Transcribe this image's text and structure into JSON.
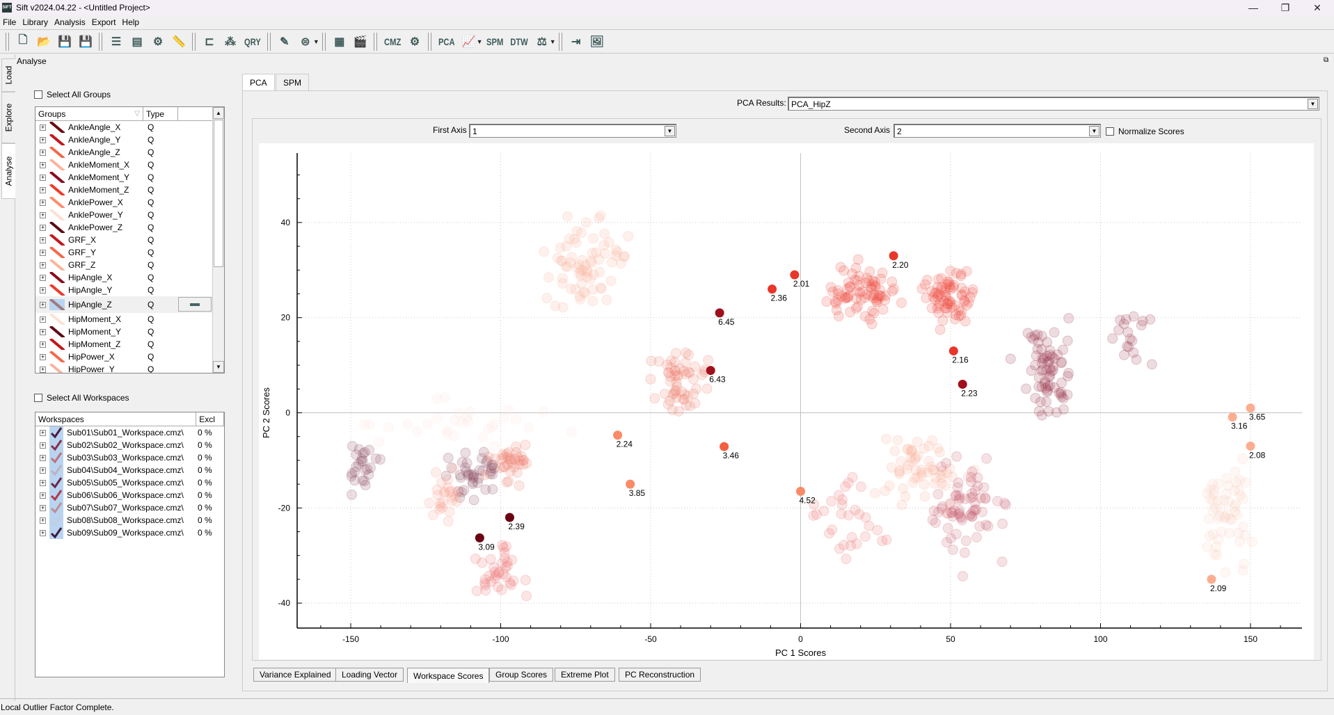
{
  "window": {
    "title": "Sift v2024.04.22 - <Untitled Project>",
    "logo": "SIFT"
  },
  "menu": [
    "File",
    "Library",
    "Analysis",
    "Export",
    "Help"
  ],
  "toolbar": {
    "groups": [
      [
        {
          "icon": "new-file-icon",
          "glyph": "🗋"
        },
        {
          "icon": "open-folder-icon",
          "glyph": "📂"
        },
        {
          "icon": "save-icon",
          "glyph": "💾"
        },
        {
          "icon": "save-as-icon",
          "glyph": "💾",
          "disabled": true
        }
      ],
      [
        {
          "icon": "sliders-icon",
          "glyph": "☰"
        },
        {
          "icon": "document-settings-icon",
          "glyph": "▤"
        },
        {
          "icon": "chart-settings-icon",
          "glyph": "⚙"
        },
        {
          "icon": "ruler-icon",
          "glyph": "📏"
        }
      ],
      [
        {
          "icon": "tree-layout-icon",
          "glyph": "⊏"
        },
        {
          "icon": "hierarchy-icon",
          "glyph": "⁂"
        },
        {
          "icon": "query-icon",
          "text": "QRY"
        }
      ],
      [
        {
          "icon": "pen-chart-icon",
          "glyph": "✎"
        },
        {
          "icon": "filter-icon",
          "glyph": "⊜",
          "menu": true
        }
      ],
      [
        {
          "icon": "film-icon",
          "glyph": "▦"
        },
        {
          "icon": "clapperboard-icon",
          "glyph": "🎬"
        }
      ],
      [
        {
          "icon": "cmz-convert-icon",
          "text": "CMZ"
        },
        {
          "icon": "gears-icon",
          "glyph": "⚙"
        }
      ],
      [
        {
          "icon": "pca-icon",
          "text": "PCA"
        },
        {
          "icon": "line-chart-icon",
          "glyph": "📈",
          "menu": true
        },
        {
          "icon": "spm-icon",
          "text": "SPM"
        },
        {
          "icon": "dtw-icon",
          "text": "DTW"
        },
        {
          "icon": "balance-icon",
          "glyph": "⚖",
          "menu": true
        }
      ],
      [
        {
          "icon": "export-icon",
          "glyph": "⇥"
        },
        {
          "icon": "export-image-icon",
          "glyph": "🖼"
        }
      ]
    ]
  },
  "side_tabs": [
    "Load",
    "Explore",
    "Analyse"
  ],
  "panel_title": "Analyse",
  "groups_panel": {
    "select_all_label": "Select All Groups",
    "headers": [
      "Groups",
      "Type",
      ""
    ],
    "rows": [
      {
        "name": "AnkleAngle_X",
        "type": "Q",
        "color": "#6b0a14"
      },
      {
        "name": "AnkleAngle_Y",
        "type": "Q",
        "color": "#c4161c"
      },
      {
        "name": "AnkleAngle_Z",
        "type": "Q",
        "color": "#f26a4a"
      },
      {
        "name": "AnkleMoment_X",
        "type": "Q",
        "color": "#fbb49c"
      },
      {
        "name": "AnkleMoment_Y",
        "type": "Q",
        "color": "#8b0a1e"
      },
      {
        "name": "AnkleMoment_Z",
        "type": "Q",
        "color": "#ee3a2c"
      },
      {
        "name": "AnklePower_X",
        "type": "Q",
        "color": "#fb8f6e"
      },
      {
        "name": "AnklePower_Y",
        "type": "Q",
        "color": "#fde0d4"
      },
      {
        "name": "AnklePower_Z",
        "type": "Q",
        "color": "#5c0a14"
      },
      {
        "name": "GRF_X",
        "type": "Q",
        "color": "#c4161c"
      },
      {
        "name": "GRF_Y",
        "type": "Q",
        "color": "#f26a4a"
      },
      {
        "name": "GRF_Z",
        "type": "Q",
        "color": "#fbb49c"
      },
      {
        "name": "HipAngle_X",
        "type": "Q",
        "color": "#8b0a1e"
      },
      {
        "name": "HipAngle_Y",
        "type": "Q",
        "color": "#ee3a2c"
      },
      {
        "name": "HipAngle_Z",
        "type": "Q",
        "color": "#a07a80",
        "selected": true
      },
      {
        "name": "HipMoment_X",
        "type": "Q",
        "color": "#fde0d4"
      },
      {
        "name": "HipMoment_Y",
        "type": "Q",
        "color": "#5c0a14"
      },
      {
        "name": "HipMoment_Z",
        "type": "Q",
        "color": "#c4161c"
      },
      {
        "name": "HipPower_X",
        "type": "Q",
        "color": "#f26a4a"
      },
      {
        "name": "HipPower_Y",
        "type": "Q",
        "color": "#fbb49c"
      }
    ]
  },
  "workspaces_panel": {
    "select_all_label": "Select All Workspaces",
    "headers": [
      "Workspaces",
      "Excl"
    ],
    "rows": [
      {
        "name": "Sub01\\Sub01_Workspace.cmz\\",
        "excl": "0 %",
        "color": "#4a1a40"
      },
      {
        "name": "Sub02\\Sub02_Workspace.cmz\\",
        "excl": "0 %",
        "color": "#8c2a4a"
      },
      {
        "name": "Sub03\\Sub03_Workspace.cmz\\",
        "excl": "0 %",
        "color": "#c0707a"
      },
      {
        "name": "Sub04\\Sub04_Workspace.cmz\\",
        "excl": "0 %",
        "color": "#c0b0c0"
      },
      {
        "name": "Sub05\\Sub05_Workspace.cmz\\",
        "excl": "0 %",
        "color": "#6a2648"
      },
      {
        "name": "Sub06\\Sub06_Workspace.cmz\\",
        "excl": "0 %",
        "color": "#b0384a"
      },
      {
        "name": "Sub07\\Sub07_Workspace.cmz\\",
        "excl": "0 %",
        "color": "#c08c94"
      },
      {
        "name": "Sub08\\Sub08_Workspace.cmz\\",
        "excl": "0 %",
        "color": "#c4cce0"
      },
      {
        "name": "Sub09\\Sub09_Workspace.cmz\\",
        "excl": "0 %",
        "color": "#3a1a40"
      }
    ]
  },
  "main_tabs": [
    {
      "label": "PCA",
      "active": true
    },
    {
      "label": "SPM"
    }
  ],
  "pca": {
    "results_label": "PCA Results:",
    "results_value": "PCA_HipZ",
    "first_axis_label": "First Axis",
    "first_axis_value": "1",
    "second_axis_label": "Second Axis",
    "second_axis_value": "2",
    "normalize_label": "Normalize Scores",
    "normalize_checked": false
  },
  "bottom_tabs": [
    {
      "label": "Variance Explained"
    },
    {
      "label": "Loading Vector"
    },
    {
      "label": "Workspace Scores",
      "active": true
    },
    {
      "label": "Group Scores"
    },
    {
      "label": "Extreme Plot"
    },
    {
      "label": "PC Reconstruction"
    }
  ],
  "status": "Local Outlier Factor Complete.",
  "chart_data": {
    "type": "scatter",
    "title": "",
    "xlabel": "PC 1 Scores",
    "ylabel": "PC 2 Scores",
    "xlim": [
      -168,
      168
    ],
    "ylim": [
      -45,
      55
    ],
    "xticks": [
      -150,
      -100,
      -50,
      0,
      50,
      100,
      150
    ],
    "yticks": [
      -40,
      -20,
      0,
      20,
      40
    ],
    "grid": "dotted",
    "outliers": [
      {
        "x": 31,
        "y": 33,
        "label": "2.20",
        "color": "#e8362a"
      },
      {
        "x": -2,
        "y": 29,
        "label": "2.01",
        "color": "#e8362a"
      },
      {
        "x": -9.5,
        "y": 26,
        "label": "2.36",
        "color": "#e8362a"
      },
      {
        "x": -27,
        "y": 21,
        "label": "6.45",
        "color": "#a0101c"
      },
      {
        "x": -30,
        "y": 8.9,
        "label": "6.43",
        "color": "#a0101c"
      },
      {
        "x": 51,
        "y": 13,
        "label": "2.16",
        "color": "#e8362a"
      },
      {
        "x": 54,
        "y": 6,
        "label": "2.23",
        "color": "#a0101c"
      },
      {
        "x": -61,
        "y": -4.7,
        "label": "2.24",
        "color": "#fb8a66"
      },
      {
        "x": -25.5,
        "y": -7.1,
        "label": "3.46",
        "color": "#f4603e"
      },
      {
        "x": -56.8,
        "y": -15,
        "label": "3.85",
        "color": "#fb8a66"
      },
      {
        "x": 0,
        "y": -16.5,
        "label": "4.52",
        "color": "#fb8a66"
      },
      {
        "x": -97,
        "y": -22,
        "label": "2.39",
        "color": "#6a0012"
      },
      {
        "x": -107,
        "y": -26.3,
        "label": "3.09",
        "color": "#6a0012"
      },
      {
        "x": 150,
        "y": 1,
        "label": "3.65",
        "color": "#fcae90"
      },
      {
        "x": 144,
        "y": -0.9,
        "label": "3.16",
        "color": "#fcae90"
      },
      {
        "x": 150,
        "y": -7,
        "label": "2.08",
        "color": "#fcae90"
      },
      {
        "x": 137,
        "y": -35,
        "label": "2.09",
        "color": "#fcae90"
      }
    ],
    "clusters": [
      {
        "cx": -72,
        "cy": 32,
        "sx": 11,
        "sy": 8,
        "n": 70,
        "color": "#fbb49c"
      },
      {
        "cx": -40,
        "cy": 7,
        "sx": 8,
        "sy": 6,
        "n": 55,
        "color": "#f08070"
      },
      {
        "cx": 20,
        "cy": 25,
        "sx": 8,
        "sy": 4.5,
        "n": 75,
        "color": "#ee5040"
      },
      {
        "cx": 50,
        "cy": 24,
        "sx": 7,
        "sy": 4.5,
        "n": 70,
        "color": "#ee5040"
      },
      {
        "cx": 82,
        "cy": 9,
        "sx": 7,
        "sy": 7,
        "n": 70,
        "color": "#9a3a50"
      },
      {
        "cx": 110,
        "cy": 14,
        "sx": 6,
        "sy": 6,
        "n": 18,
        "color": "#9a3a50"
      },
      {
        "cx": -146,
        "cy": -11,
        "sx": 4,
        "sy": 4,
        "n": 25,
        "color": "#8a4a60"
      },
      {
        "cx": -110,
        "cy": -13,
        "sx": 7,
        "sy": 4,
        "n": 40,
        "color": "#8a4a60"
      },
      {
        "cx": -97,
        "cy": -11,
        "sx": 6,
        "sy": 4,
        "n": 35,
        "color": "#f08070"
      },
      {
        "cx": -118,
        "cy": -18,
        "sx": 4,
        "sy": 4,
        "n": 25,
        "color": "#f8a090"
      },
      {
        "cx": -100,
        "cy": -33,
        "sx": 7,
        "sy": 5,
        "n": 35,
        "color": "#ee7070"
      },
      {
        "cx": 40,
        "cy": -12,
        "sx": 12,
        "sy": 6,
        "n": 60,
        "color": "#fbb49c"
      },
      {
        "cx": 55,
        "cy": -20,
        "sx": 9,
        "sy": 8,
        "n": 70,
        "color": "#c86070"
      },
      {
        "cx": 15,
        "cy": -22,
        "sx": 8,
        "sy": 8,
        "n": 30,
        "color": "#ee7070"
      },
      {
        "cx": 142,
        "cy": -21,
        "sx": 7,
        "sy": 8,
        "n": 55,
        "color": "#fcd0c0"
      },
      {
        "cx": -110,
        "cy": -2,
        "sx": 25,
        "sy": 4,
        "n": 30,
        "color": "#fde4dc"
      }
    ]
  }
}
